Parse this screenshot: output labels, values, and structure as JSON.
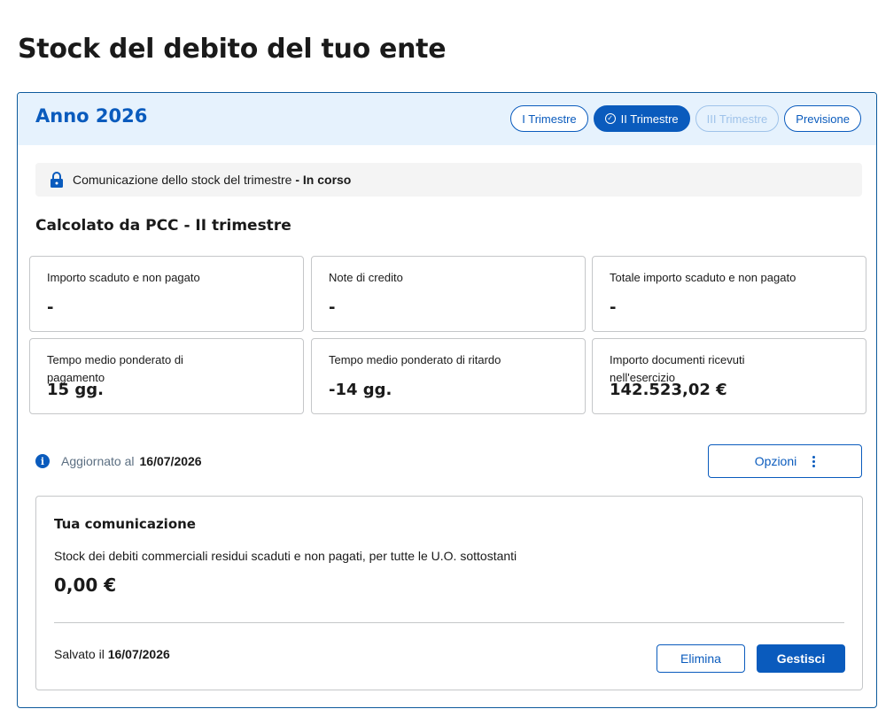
{
  "page": {
    "title": "Stock del debito del tuo ente"
  },
  "header": {
    "year_title": "Anno 2026",
    "tabs": [
      {
        "label": "I Trimestre",
        "state": "default"
      },
      {
        "label": "II Trimestre",
        "state": "active",
        "icon": "check-circle-icon"
      },
      {
        "label": "III Trimestre",
        "state": "disabled"
      },
      {
        "label": "Previsione",
        "state": "default"
      }
    ]
  },
  "status": {
    "icon": "lock-icon",
    "text": "Comunicazione dello stock del trimestre",
    "separator": " - ",
    "state": "In corso"
  },
  "section": {
    "title": "Calcolato da PCC - II trimestre"
  },
  "metrics": [
    {
      "label": "Importo scaduto e non pagato",
      "value": "-"
    },
    {
      "label": "Note di credito",
      "value": "-"
    },
    {
      "label": "Totale importo scaduto e non pagato",
      "value": "-"
    },
    {
      "label": "Tempo medio ponderato di pagamento",
      "value": "15 gg."
    },
    {
      "label": "Tempo medio ponderato di ritardo",
      "value": "-14 gg."
    },
    {
      "label": "Importo documenti ricevuti nell'esercizio",
      "value": "142.523,02 €"
    }
  ],
  "info": {
    "icon": "info-icon",
    "label": "Aggiornato al",
    "date": "16/07/2026"
  },
  "options_button": {
    "label": "Opzioni",
    "icon": "kebab-menu-icon"
  },
  "communication": {
    "title": "Tua comunicazione",
    "description": "Stock dei debiti commerciali residui scaduti e non pagati, per tutte le U.O. sottostanti",
    "amount": "0,00 €",
    "saved_label": "Salvato il",
    "saved_date": "16/07/2026",
    "delete_label": "Elimina",
    "manage_label": "Gestisci"
  },
  "colors": {
    "primary": "#0a5bbd",
    "header_bg": "#e6f2fd",
    "border": "#c5c7c9",
    "status_bg": "#f4f4f4",
    "muted_text": "#5c6f82"
  }
}
